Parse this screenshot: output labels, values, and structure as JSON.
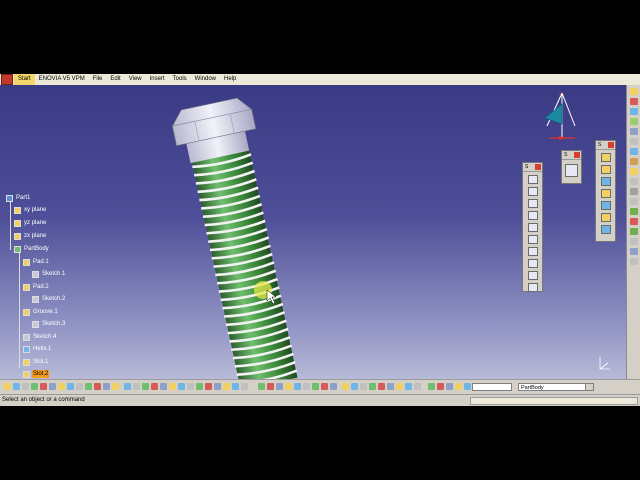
{
  "menubar": {
    "items": [
      "Start",
      "ENOVIA V5 VPM",
      "File",
      "Edit",
      "View",
      "Insert",
      "Tools",
      "Window",
      "Help"
    ]
  },
  "tree": {
    "nodes": [
      {
        "label": "Part1",
        "icon": "part-icon"
      },
      {
        "label": "xy plane",
        "icon": "plane-icon"
      },
      {
        "label": "yz plane",
        "icon": "plane-icon"
      },
      {
        "label": "zx plane",
        "icon": "plane-icon"
      },
      {
        "label": "PartBody",
        "icon": "body-icon"
      },
      {
        "label": "Pad.1",
        "icon": "pad-icon"
      },
      {
        "label": "Sketch.1",
        "icon": "sketch-icon"
      },
      {
        "label": "Pad.2",
        "icon": "pad-icon"
      },
      {
        "label": "Sketch.2",
        "icon": "sketch-icon"
      },
      {
        "label": "Groove.1",
        "icon": "groove-icon"
      },
      {
        "label": "Sketch.3",
        "icon": "sketch-icon"
      },
      {
        "label": "Sketch.4",
        "icon": "sketch-icon"
      },
      {
        "label": "Helix.1",
        "icon": "helix-icon"
      },
      {
        "label": "Slot.1",
        "icon": "slot-icon"
      },
      {
        "label": "Slot.2",
        "icon": "slot-icon",
        "selected": true
      }
    ]
  },
  "toolbars": {
    "float1_title": "S",
    "float2_title": "S",
    "float3_title": "S"
  },
  "bottombar": {
    "current_body": "PartBody"
  },
  "status": {
    "message": "Select an object or a command"
  },
  "colors": {
    "background_top": "#3a3a85",
    "background_bottom": "#b8bad8",
    "thread_green": "#2f8a2f",
    "selection_orange": "#f29a1b"
  }
}
